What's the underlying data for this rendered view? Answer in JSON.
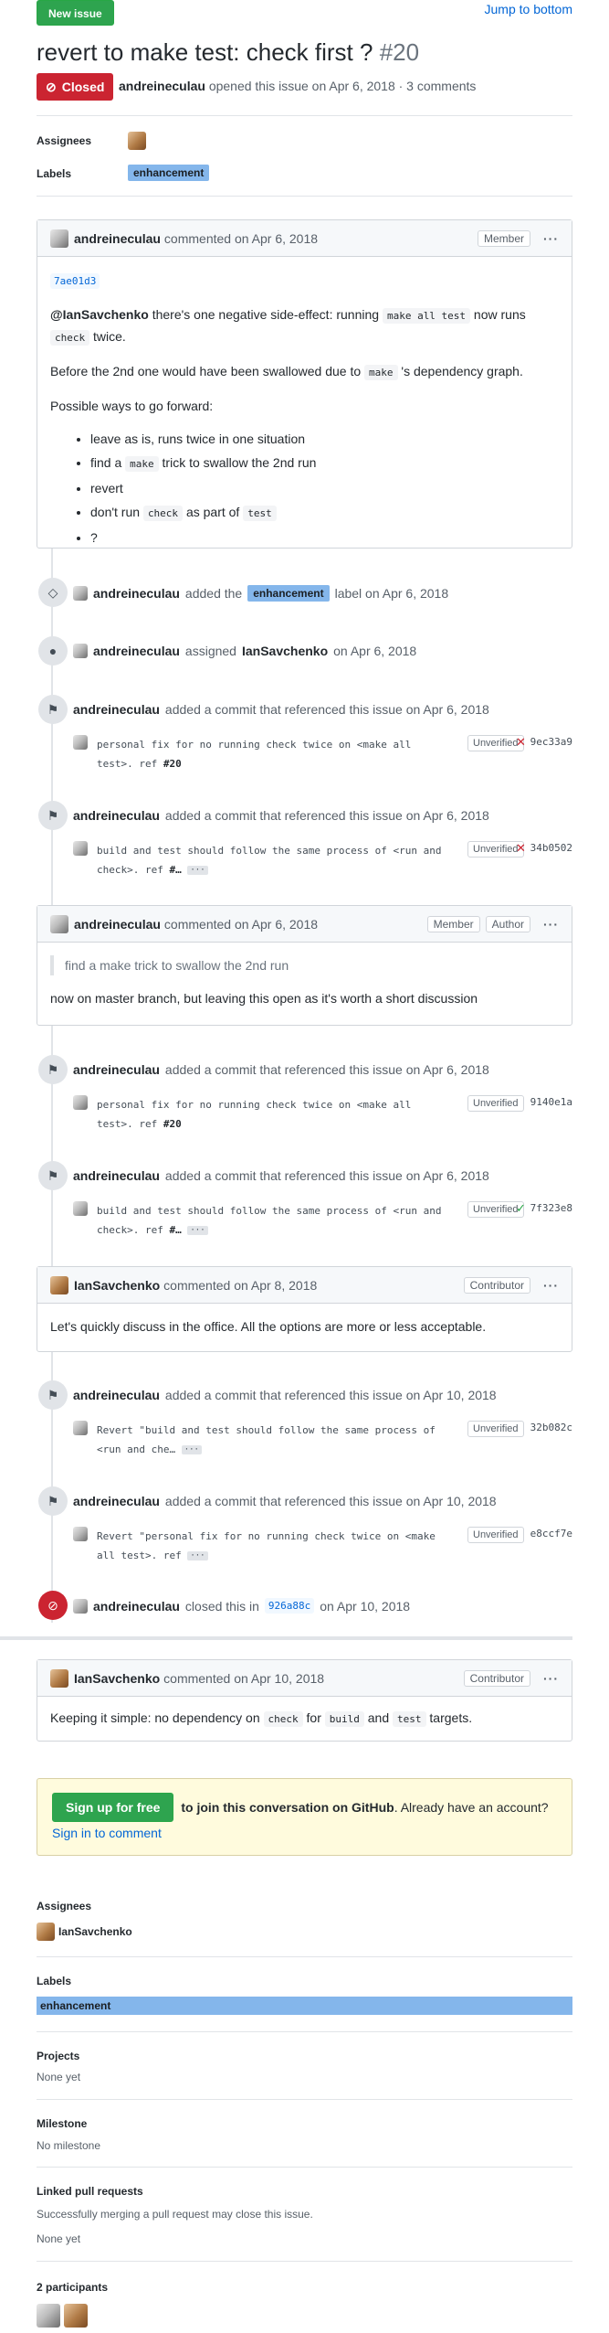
{
  "header": {
    "new_issue_label": "New issue",
    "jump_label": "Jump to bottom",
    "title": "revert to make test: check first ?",
    "number": "#20",
    "state_label": "Closed",
    "author": "andreineculau",
    "opened_text": "opened this issue on Apr 6, 2018 · 3 comments"
  },
  "top_sidebar": {
    "assignees_label": "Assignees",
    "labels_label": "Labels",
    "label": "enhancement"
  },
  "comment1": {
    "author": "andreineculau",
    "time": "commented on Apr 6, 2018",
    "role": "Member",
    "sha": "7ae01d3",
    "p1_a": "@IanSavchenko",
    "p1_b": " there's one negative side-effect: running ",
    "p1_code1": "make all test",
    "p1_c": " now runs",
    "p1_code2": "check",
    "p1_d": " twice.",
    "p2_a": "Before the 2nd one would have been swallowed due to ",
    "p2_code": "make",
    "p2_b": " 's dependency graph.",
    "p3": "Possible ways to go forward:",
    "opt1": "leave as is, runs twice in one situation",
    "opt2_a": "find a ",
    "opt2_code": "make",
    "opt2_b": " trick to swallow the 2nd run",
    "opt3": "revert",
    "opt4_a": "don't run ",
    "opt4_code1": "check",
    "opt4_b": " as part of ",
    "opt4_code2": "test",
    "opt5": "?"
  },
  "events": {
    "label_author": "andreineculau",
    "label_a": "added the",
    "label_name": "enhancement",
    "label_b": "label on Apr 6, 2018",
    "assign_author": "andreineculau",
    "assign_a": "assigned",
    "assign_target": "IanSavchenko",
    "assign_b": "on Apr 6, 2018",
    "commit_author": "andreineculau",
    "commit_text_apr6": "added a commit that referenced this issue on Apr 6, 2018",
    "commit_text_apr10": "added a commit that referenced this issue on Apr 10, 2018",
    "closed_author": "andreineculau",
    "closed_a": "closed this in",
    "closed_sha": "926a88c",
    "closed_b": "on Apr 10, 2018"
  },
  "commits": [
    {
      "line1": "personal fix for no running check twice on <make all",
      "line2": "test>. ref ",
      "ref": "#20",
      "status": "Unverified",
      "ci": "fail",
      "sha": "9ec33a9"
    },
    {
      "line1": "build and test should follow the same process of <run and",
      "line2": "check>. ref ",
      "ref": "#…",
      "status": "Unverified",
      "ci": "fail",
      "sha": "34b0502"
    },
    {
      "line1": "personal fix for no running check twice on <make all",
      "line2": "test>. ref ",
      "ref": "#20",
      "status": "Unverified",
      "ci": "none",
      "sha": "9140e1a"
    },
    {
      "line1": "build and test should follow the same process of <run and",
      "line2": "check>. ref ",
      "ref": "#…",
      "status": "Unverified",
      "ci": "ok",
      "sha": "7f323e8"
    },
    {
      "line1": "Revert \"build and test should follow the same process of",
      "line2": "<run and che…",
      "ref": "",
      "status": "Unverified",
      "ci": "none",
      "sha": "32b082c"
    },
    {
      "line1": "Revert \"personal fix for no running check twice on <make",
      "line2": "all test>. ref",
      "ref": "",
      "status": "Unverified",
      "ci": "none",
      "sha": "e8ccf7e"
    }
  ],
  "comment2": {
    "author": "andreineculau",
    "time": "commented on Apr 6, 2018",
    "role1": "Member",
    "role2": "Author",
    "quote": "find a make trick to swallow the 2nd run",
    "body": "now on master branch, but leaving this open as it's worth a short discussion"
  },
  "comment3": {
    "author": "IanSavchenko",
    "time": "commented on Apr 8, 2018",
    "role": "Contributor",
    "body": "Let's quickly discuss in the office. All the options are more or less acceptable."
  },
  "comment4": {
    "author": "IanSavchenko",
    "time": "commented on Apr 10, 2018",
    "role": "Contributor",
    "b_a": "Keeping it simple: no dependency on ",
    "b_code1": "check",
    "b_b": " for ",
    "b_code2": "build",
    "b_c": " and ",
    "b_code3": "test",
    "b_d": " targets."
  },
  "signup": {
    "button": "Sign up for free",
    "bold": "to join this conversation on GitHub",
    "text": ". Already have an account? ",
    "link": "Sign in to comment"
  },
  "sidebar": {
    "assignees_label": "Assignees",
    "assignee": "IanSavchenko",
    "labels_label": "Labels",
    "label": "enhancement",
    "projects_label": "Projects",
    "projects_value": "None yet",
    "milestone_label": "Milestone",
    "milestone_value": "No milestone",
    "linked_label": "Linked pull requests",
    "linked_desc": "Successfully merging a pull request may close this issue.",
    "linked_value": "None yet",
    "participants_label": "2 participants"
  },
  "colors": {
    "green": "#2ea44f",
    "closed_red": "#cb2431",
    "label_blue": "#84b6eb",
    "link_blue": "#0366d6"
  }
}
